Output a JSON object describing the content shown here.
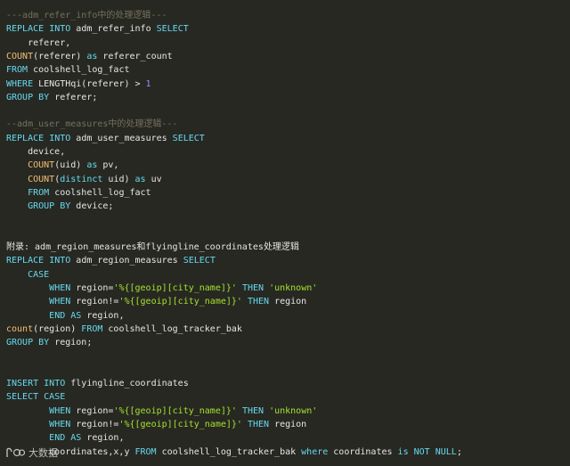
{
  "watermark": {
    "text": "大数据",
    "logo": "bigdata-logo"
  },
  "colors": {
    "background": "#272822",
    "keyword": "#66d9ef",
    "function": "#f4bf75",
    "string": "#a6e22e",
    "number": "#ae81ff",
    "comment": "#75715e",
    "plain": "#e6e6e6"
  },
  "lines": [
    [
      [
        "cm",
        "---adm_refer_info中的处理逻辑---"
      ]
    ],
    [
      [
        "kw",
        "REPLACE"
      ],
      [
        "pl",
        " "
      ],
      [
        "kw",
        "INTO"
      ],
      [
        "pl",
        " adm_refer_info "
      ],
      [
        "kw",
        "SELECT"
      ]
    ],
    [
      [
        "pl",
        "    referer,"
      ]
    ],
    [
      [
        "fn",
        "COUNT"
      ],
      [
        "pl",
        "(referer) "
      ],
      [
        "kw",
        "as"
      ],
      [
        "pl",
        " referer_count"
      ]
    ],
    [
      [
        "kw",
        "FROM"
      ],
      [
        "pl",
        " coolshell_log_fact"
      ]
    ],
    [
      [
        "kw",
        "WHERE"
      ],
      [
        "pl",
        " LENGTHqi(referer) > "
      ],
      [
        "num",
        "1"
      ]
    ],
    [
      [
        "kw",
        "GROUP"
      ],
      [
        "pl",
        " "
      ],
      [
        "kw",
        "BY"
      ],
      [
        "pl",
        " referer;"
      ]
    ],
    [],
    [
      [
        "cm",
        "--adm_user_measures中的处理逻辑---"
      ]
    ],
    [
      [
        "kw",
        "REPLACE"
      ],
      [
        "pl",
        " "
      ],
      [
        "kw",
        "INTO"
      ],
      [
        "pl",
        " adm_user_measures "
      ],
      [
        "kw",
        "SELECT"
      ]
    ],
    [
      [
        "pl",
        "    device,"
      ]
    ],
    [
      [
        "pl",
        "    "
      ],
      [
        "fn",
        "COUNT"
      ],
      [
        "pl",
        "(uid) "
      ],
      [
        "kw",
        "as"
      ],
      [
        "pl",
        " pv,"
      ]
    ],
    [
      [
        "pl",
        "    "
      ],
      [
        "fn",
        "COUNT"
      ],
      [
        "pl",
        "("
      ],
      [
        "kw",
        "distinct"
      ],
      [
        "pl",
        " uid) "
      ],
      [
        "kw",
        "as"
      ],
      [
        "pl",
        " uv"
      ]
    ],
    [
      [
        "pl",
        "    "
      ],
      [
        "kw",
        "FROM"
      ],
      [
        "pl",
        " coolshell_log_fact"
      ]
    ],
    [
      [
        "pl",
        "    "
      ],
      [
        "kw",
        "GROUP"
      ],
      [
        "pl",
        " "
      ],
      [
        "kw",
        "BY"
      ],
      [
        "pl",
        " device;"
      ]
    ],
    [],
    [],
    [
      [
        "pl",
        "附录: adm_region_measures和flyingline_coordinates处理逻辑"
      ]
    ],
    [
      [
        "kw",
        "REPLACE"
      ],
      [
        "pl",
        " "
      ],
      [
        "kw",
        "INTO"
      ],
      [
        "pl",
        " adm_region_measures "
      ],
      [
        "kw",
        "SELECT"
      ]
    ],
    [
      [
        "pl",
        "    "
      ],
      [
        "kw",
        "CASE"
      ]
    ],
    [
      [
        "pl",
        "        "
      ],
      [
        "kw",
        "WHEN"
      ],
      [
        "pl",
        " region="
      ],
      [
        "str",
        "'%{[geoip][city_name]}'"
      ],
      [
        "pl",
        " "
      ],
      [
        "kw",
        "THEN"
      ],
      [
        "pl",
        " "
      ],
      [
        "str",
        "'unknown'"
      ]
    ],
    [
      [
        "pl",
        "        "
      ],
      [
        "kw",
        "WHEN"
      ],
      [
        "pl",
        " region!="
      ],
      [
        "str",
        "'%{[geoip][city_name]}'"
      ],
      [
        "pl",
        " "
      ],
      [
        "kw",
        "THEN"
      ],
      [
        "pl",
        " region"
      ]
    ],
    [
      [
        "pl",
        "        "
      ],
      [
        "kw",
        "END"
      ],
      [
        "pl",
        " "
      ],
      [
        "kw",
        "AS"
      ],
      [
        "pl",
        " region,"
      ]
    ],
    [
      [
        "fn",
        "count"
      ],
      [
        "pl",
        "(region) "
      ],
      [
        "kw",
        "FROM"
      ],
      [
        "pl",
        " coolshell_log_tracker_bak"
      ]
    ],
    [
      [
        "kw",
        "GROUP"
      ],
      [
        "pl",
        " "
      ],
      [
        "kw",
        "BY"
      ],
      [
        "pl",
        " region;"
      ]
    ],
    [],
    [],
    [
      [
        "kw",
        "INSERT"
      ],
      [
        "pl",
        " "
      ],
      [
        "kw",
        "INTO"
      ],
      [
        "pl",
        " flyingline_coordinates"
      ]
    ],
    [
      [
        "kw",
        "SELECT"
      ],
      [
        "pl",
        " "
      ],
      [
        "kw",
        "CASE"
      ]
    ],
    [
      [
        "pl",
        "        "
      ],
      [
        "kw",
        "WHEN"
      ],
      [
        "pl",
        " region="
      ],
      [
        "str",
        "'%{[geoip][city_name]}'"
      ],
      [
        "pl",
        " "
      ],
      [
        "kw",
        "THEN"
      ],
      [
        "pl",
        " "
      ],
      [
        "str",
        "'unknown'"
      ]
    ],
    [
      [
        "pl",
        "        "
      ],
      [
        "kw",
        "WHEN"
      ],
      [
        "pl",
        " region!="
      ],
      [
        "str",
        "'%{[geoip][city_name]}'"
      ],
      [
        "pl",
        " "
      ],
      [
        "kw",
        "THEN"
      ],
      [
        "pl",
        " region"
      ]
    ],
    [
      [
        "pl",
        "        "
      ],
      [
        "kw",
        "END"
      ],
      [
        "pl",
        " "
      ],
      [
        "kw",
        "AS"
      ],
      [
        "pl",
        " region,"
      ]
    ],
    [
      [
        "pl",
        "        coordinates,x,y "
      ],
      [
        "kw",
        "FROM"
      ],
      [
        "pl",
        " coolshell_log_tracker_bak "
      ],
      [
        "kw",
        "where"
      ],
      [
        "pl",
        " coordinates "
      ],
      [
        "kw",
        "is"
      ],
      [
        "pl",
        " "
      ],
      [
        "kw",
        "NOT"
      ],
      [
        "pl",
        " "
      ],
      [
        "kw",
        "NULL"
      ],
      [
        "pl",
        ";"
      ]
    ]
  ]
}
